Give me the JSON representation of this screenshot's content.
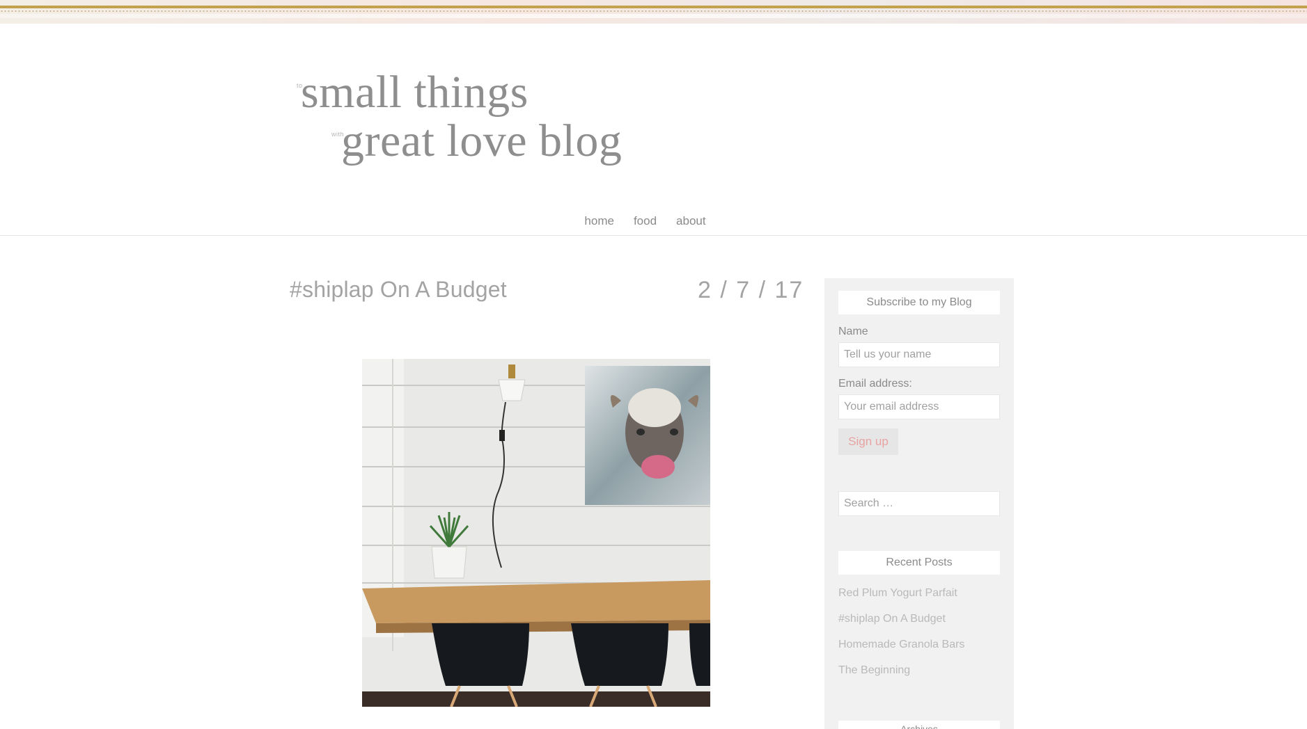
{
  "site": {
    "logo_small1": "to",
    "logo_line1": "small things",
    "logo_small2": "with",
    "logo_line2": "great love blog"
  },
  "nav": {
    "items": [
      {
        "label": "home"
      },
      {
        "label": "food"
      },
      {
        "label": "about"
      }
    ]
  },
  "post": {
    "title": "#shiplap On A Budget",
    "date": "2 / 7 / 17"
  },
  "sidebar": {
    "subscribe": {
      "title": "Subscribe to my Blog",
      "name_label": "Name",
      "name_placeholder": "Tell us your name",
      "email_label": "Email address:",
      "email_placeholder": "Your email address",
      "signup_label": "Sign up"
    },
    "search": {
      "placeholder": "Search …"
    },
    "recent": {
      "title": "Recent Posts",
      "items": [
        {
          "label": "Red Plum Yogurt Parfait"
        },
        {
          "label": "#shiplap On A Budget"
        },
        {
          "label": "Homemade Granola Bars"
        },
        {
          "label": "The Beginning"
        }
      ]
    },
    "next_widget_title": "Archives"
  },
  "colors": {
    "accent_gold": "#c3a24e",
    "signup_text": "#e8a2a2",
    "sidebar_bg": "#f1f1f1"
  }
}
